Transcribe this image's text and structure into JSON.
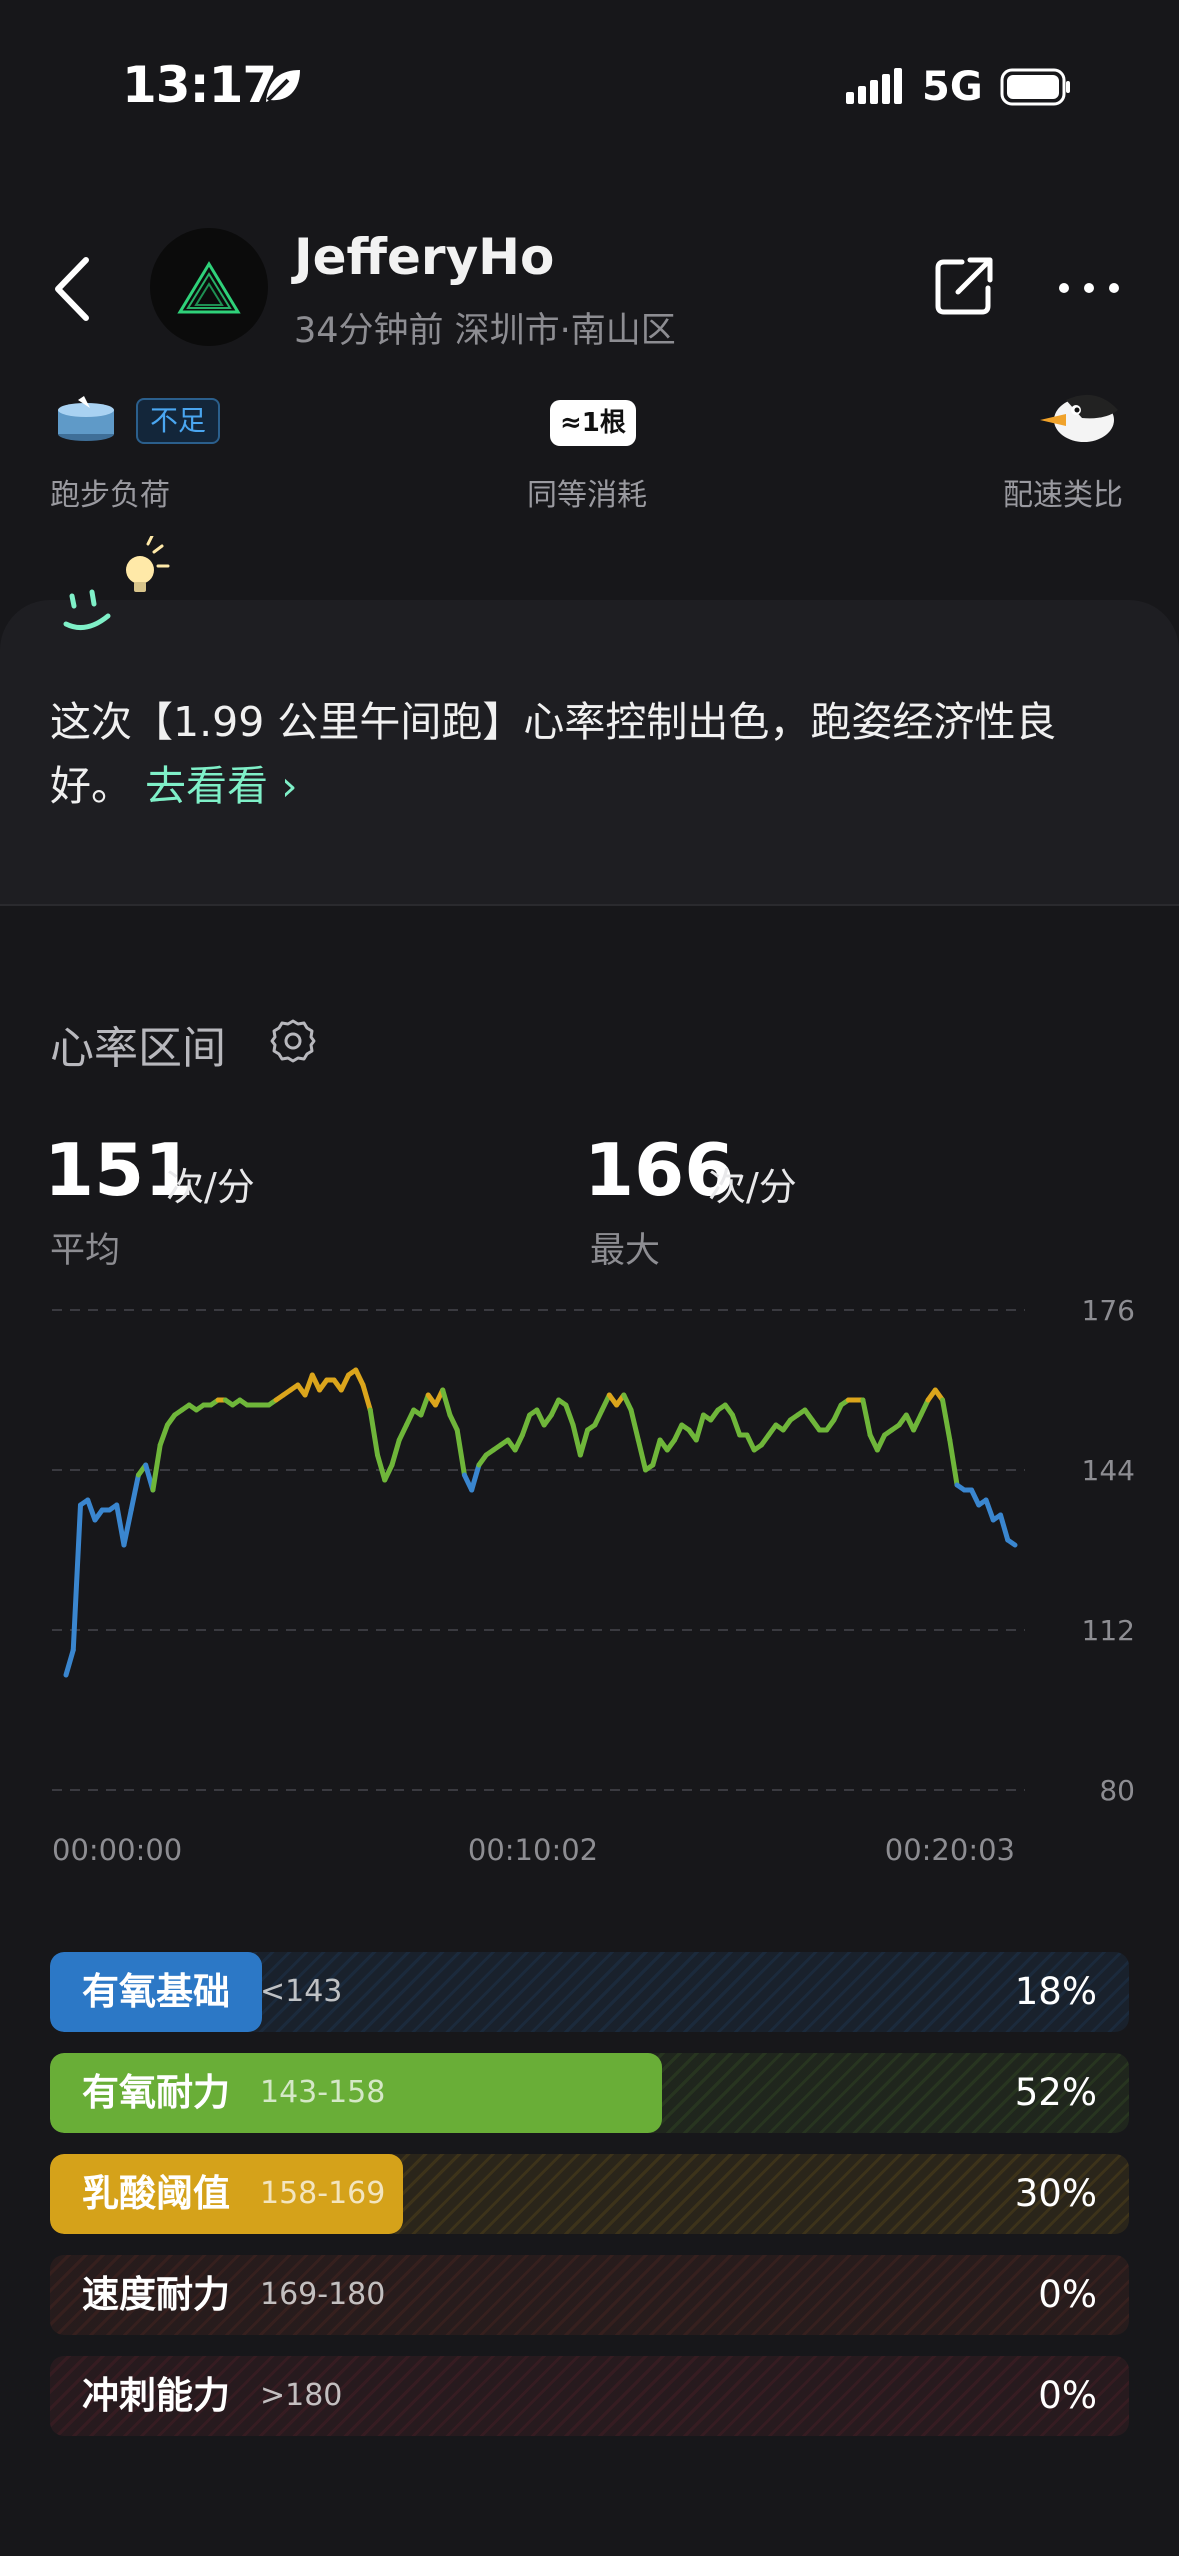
{
  "status_bar": {
    "time": "13:17",
    "network": "5G"
  },
  "header": {
    "username": "JefferyHo",
    "subinfo": "34分钟前  深圳市·南山区"
  },
  "stats": [
    {
      "label": "跑步负荷",
      "tag": "不足"
    },
    {
      "label": "同等消耗",
      "badge": "≈1根"
    },
    {
      "label": "配速类比"
    }
  ],
  "insight": {
    "text": "这次【1.99 公里午间跑】心率控制出色，跑姿经济性良好。",
    "link_label": "去看看 ›"
  },
  "heart": {
    "title": "心率区间",
    "avg_value": "151",
    "avg_unit": "次/分",
    "avg_label": "平均",
    "max_value": "166",
    "max_unit": "次/分",
    "max_label": "最大"
  },
  "chart_data": {
    "type": "line",
    "x_labels": [
      "00:00:00",
      "00:10:02",
      "00:20:03"
    ],
    "y_ticks": [
      176,
      144,
      112,
      80
    ],
    "ylim": [
      80,
      176
    ],
    "x_duration_sec": 1203,
    "grid": "dashed-horizontal",
    "zone_colors": [
      "#3a86cf",
      "#6fb63a",
      "#dba51c"
    ],
    "series": [
      {
        "values": [
          103,
          108,
          137,
          138,
          134,
          136,
          136,
          137,
          129,
          136,
          143,
          145,
          140,
          149,
          153,
          155,
          156,
          157,
          156,
          157,
          157,
          158,
          158,
          157,
          158,
          157,
          157,
          157,
          157,
          158,
          159,
          160,
          161,
          159,
          163,
          160,
          162,
          162,
          160,
          163,
          164,
          161,
          156,
          147,
          142,
          145,
          150,
          153,
          156,
          155,
          159,
          157,
          160,
          155,
          152,
          143,
          140,
          145,
          147,
          148,
          149,
          150,
          148,
          151,
          155,
          156,
          153,
          155,
          158,
          157,
          153,
          147,
          152,
          153,
          156,
          159,
          157,
          159,
          156,
          150,
          144,
          145,
          150,
          148,
          150,
          153,
          152,
          150,
          155,
          154,
          156,
          157,
          155,
          151,
          151,
          148,
          149,
          151,
          153,
          152,
          154,
          155,
          156,
          154,
          152,
          152,
          154,
          157,
          158,
          158,
          158,
          151,
          148,
          151,
          152,
          153,
          155,
          152,
          155,
          158,
          160,
          158,
          150,
          141,
          140,
          140,
          137,
          138,
          134,
          135,
          130,
          129
        ]
      }
    ]
  },
  "zones": [
    {
      "name": "有氧基础",
      "range": "<143",
      "pct": "18%",
      "pct_value": 18,
      "color": "#2c78c6"
    },
    {
      "name": "有氧耐力",
      "range": "143-158",
      "pct": "52%",
      "pct_value": 52,
      "color": "#69ae37"
    },
    {
      "name": "乳酸阈值",
      "range": "158-169",
      "pct": "30%",
      "pct_value": 30,
      "color": "#d5a21a"
    },
    {
      "name": "速度耐力",
      "range": "169-180",
      "pct": "0%",
      "pct_value": 0,
      "color": "#b2422d"
    },
    {
      "name": "冲刺能力",
      "range": ">180",
      "pct": "0%",
      "pct_value": 0,
      "color": "#b3323f"
    }
  ]
}
